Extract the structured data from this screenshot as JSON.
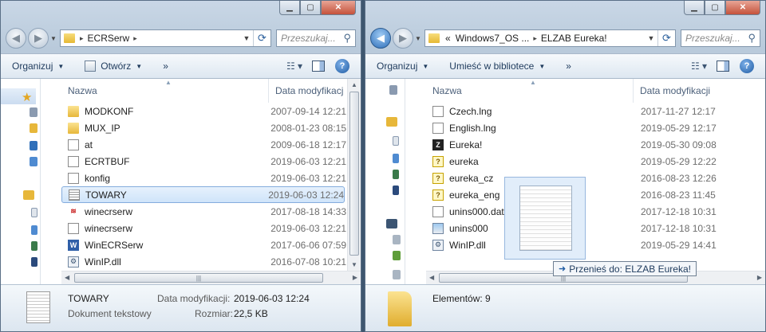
{
  "left_window": {
    "address": {
      "crumbs": [
        "ECRSerw"
      ]
    },
    "search_placeholder": "Przeszukaj...",
    "toolbar": {
      "organize": "Organizuj",
      "open": "Otwórz",
      "more": "»"
    },
    "columns": {
      "name": "Nazwa",
      "date": "Data modyfikacj"
    },
    "files": [
      {
        "name": "MODKONF",
        "date": "2007-09-14 12:21",
        "icon": "folder-icon"
      },
      {
        "name": "MUX_IP",
        "date": "2008-01-23 08:15",
        "icon": "folder-icon"
      },
      {
        "name": "at",
        "date": "2009-06-18 12:17",
        "icon": "file-icon"
      },
      {
        "name": "ECRTBUF",
        "date": "2019-06-03 12:21",
        "icon": "file-icon"
      },
      {
        "name": "konfig",
        "date": "2019-06-03 12:21",
        "icon": "file-icon"
      },
      {
        "name": "TOWARY",
        "date": "2019-06-03 12:24",
        "icon": "text-file-icon",
        "selected": true
      },
      {
        "name": "winecrserw",
        "date": "2017-08-18 14:33",
        "icon": "app-logo-icon"
      },
      {
        "name": "winecrserw",
        "date": "2019-06-03 12:21",
        "icon": "config-file-icon"
      },
      {
        "name": "WinECRSerw",
        "date": "2017-06-06 07:59",
        "icon": "word-doc-icon"
      },
      {
        "name": "WinIP.dll",
        "date": "2016-07-08 10:21",
        "icon": "dll-file-icon"
      }
    ],
    "details": {
      "name": "TOWARY",
      "type": "Dokument tekstowy",
      "modified_label": "Data modyfikacji:",
      "modified_value": "2019-06-03 12:24",
      "size_label": "Rozmiar:",
      "size_value": "22,5 KB"
    }
  },
  "right_window": {
    "address": {
      "prefix": "«",
      "crumbs": [
        "Windows7_OS ...",
        "ELZAB Eureka!"
      ]
    },
    "search_placeholder": "Przeszukaj...",
    "toolbar": {
      "organize": "Organizuj",
      "library": "Umieść w bibliotece",
      "more": "»"
    },
    "columns": {
      "name": "Nazwa",
      "date": "Data modyfikacji"
    },
    "files": [
      {
        "name": "Czech.lng",
        "date": "2017-11-27 12:17",
        "icon": "file-icon"
      },
      {
        "name": "English.lng",
        "date": "2019-05-29 12:17",
        "icon": "file-icon"
      },
      {
        "name": "Eureka!",
        "date": "2019-05-30 09:08",
        "icon": "eureka-app-icon"
      },
      {
        "name": "eureka",
        "date": "2019-05-29 12:22",
        "icon": "help-file-icon"
      },
      {
        "name": "eureka_cz",
        "date": "2016-08-23 12:26",
        "icon": "help-file-icon"
      },
      {
        "name": "eureka_eng",
        "date": "2016-08-23 11:45",
        "icon": "help-file-icon"
      },
      {
        "name": "unins000.dat",
        "date": "2017-12-18 10:31",
        "icon": "file-icon"
      },
      {
        "name": "unins000",
        "date": "2017-12-18 10:31",
        "icon": "uninstaller-icon"
      },
      {
        "name": "WinIP.dll",
        "date": "2019-05-29 14:41",
        "icon": "dll-file-icon"
      }
    ],
    "details": {
      "count": "Elementów: 9"
    }
  },
  "drag": {
    "tooltip": "Przenieś do: ELZAB Eureka!"
  }
}
